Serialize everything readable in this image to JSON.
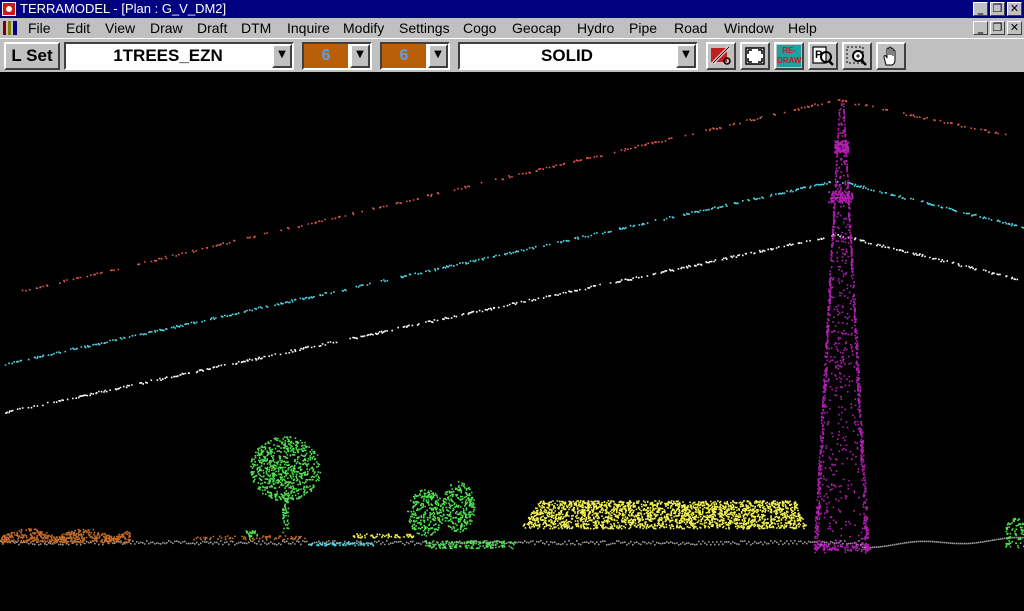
{
  "window": {
    "title": "TERRAMODEL - [Plan : G_V_DM2]"
  },
  "menu": {
    "items": [
      "File",
      "Edit",
      "View",
      "Draw",
      "Draft",
      "DTM",
      "Inquire",
      "Modify",
      "Settings",
      "Cogo",
      "Geocap",
      "Hydro",
      "Pipe",
      "Road",
      "Window",
      "Help"
    ]
  },
  "toolbar": {
    "lset_label": "L Set",
    "layer_value": "1TREES_EZN",
    "color_value_1": "6",
    "color_value_2": "6",
    "linetype_value": "SOLID",
    "redraw_label_top": "RE-",
    "redraw_label_bottom": "DRAW"
  },
  "icons": {
    "app": "terramodel-app-icon",
    "doc": "document-icon",
    "minimize": "minimize-icon",
    "restore": "restore-icon",
    "close": "close-icon",
    "dropdown": "dropdown-arrow-icon",
    "pen_settings": "pen-settings-icon",
    "zoom_extents": "zoom-extents-icon",
    "zoom_previous": "zoom-previous-icon",
    "zoom_window": "zoom-window-icon",
    "pan": "pan-hand-icon"
  },
  "colors": {
    "title_bar": "#000080",
    "canvas_bg": "#000000",
    "top_wire": "#e05a50",
    "middle_wire": "#50d8e8",
    "lower_wire": "#ffffff",
    "tower": "#b020b0",
    "vegetation": "#50e050",
    "building_roof": "#f0f050",
    "ground_left": "#c06a28",
    "ground_right": "#9a9a9a",
    "color_swatch": "#b85f08"
  }
}
